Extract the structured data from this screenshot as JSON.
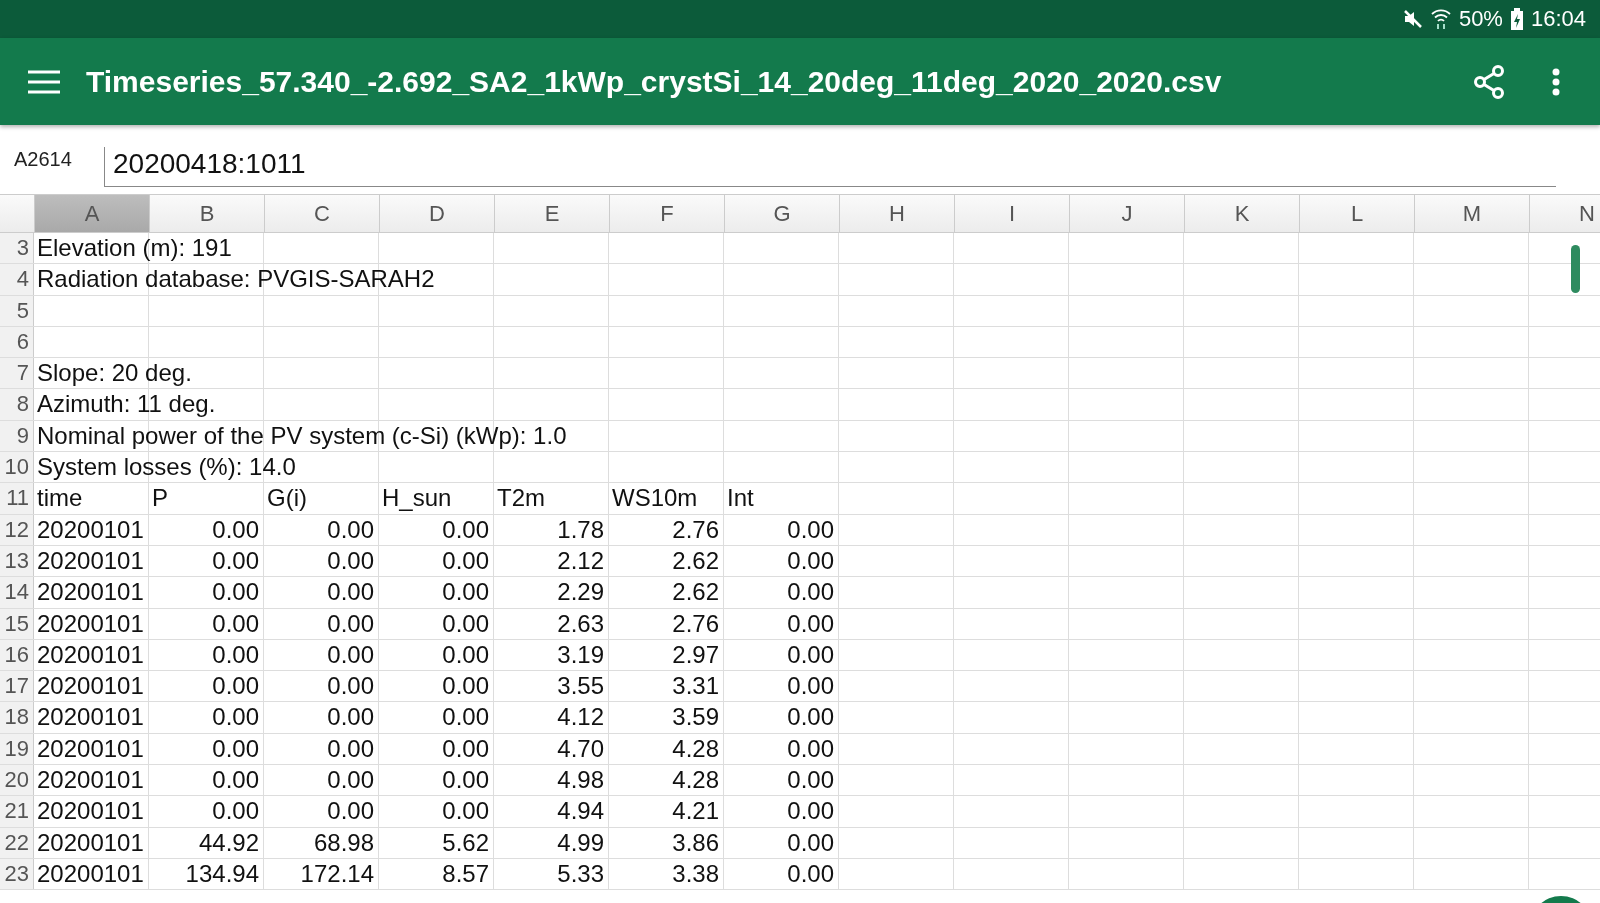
{
  "status_bar": {
    "battery": "50%",
    "time": "16:04"
  },
  "app_bar": {
    "title": "Timeseries_57.340_-2.692_SA2_1kWp_crystSi_14_20deg_11deg_2020_2020.csv"
  },
  "formula_bar": {
    "cell_ref": "A2614",
    "value": "20200418:1011"
  },
  "columns": [
    {
      "label": "A",
      "selected": true
    },
    {
      "label": "B",
      "selected": false
    },
    {
      "label": "C",
      "selected": false
    },
    {
      "label": "D",
      "selected": false
    },
    {
      "label": "E",
      "selected": false
    },
    {
      "label": "F",
      "selected": false
    },
    {
      "label": "G",
      "selected": false
    },
    {
      "label": "H",
      "selected": false
    },
    {
      "label": "I",
      "selected": false
    },
    {
      "label": "J",
      "selected": false
    },
    {
      "label": "K",
      "selected": false
    },
    {
      "label": "L",
      "selected": false
    },
    {
      "label": "M",
      "selected": false
    },
    {
      "label": "N",
      "selected": false
    }
  ],
  "rows": [
    {
      "number": "3",
      "kind": "note",
      "text": "Elevation (m): 191"
    },
    {
      "number": "4",
      "kind": "note",
      "text": "Radiation database: PVGIS-SARAH2"
    },
    {
      "number": "5",
      "kind": "empty"
    },
    {
      "number": "6",
      "kind": "empty"
    },
    {
      "number": "7",
      "kind": "note",
      "text": "Slope: 20 deg."
    },
    {
      "number": "8",
      "kind": "note",
      "text": "Azimuth: 11 deg."
    },
    {
      "number": "9",
      "kind": "note",
      "text": "Nominal power of the PV system (c-Si) (kWp): 1.0"
    },
    {
      "number": "10",
      "kind": "note",
      "text": "System losses (%): 14.0"
    },
    {
      "number": "11",
      "kind": "header",
      "cells": [
        "time",
        "P",
        "G(i)",
        "H_sun",
        "T2m",
        "WS10m",
        "Int"
      ]
    },
    {
      "number": "12",
      "kind": "data",
      "cells": [
        "20200101",
        "0.00",
        "0.00",
        "0.00",
        "1.78",
        "2.76",
        "0.00"
      ]
    },
    {
      "number": "13",
      "kind": "data",
      "cells": [
        "20200101",
        "0.00",
        "0.00",
        "0.00",
        "2.12",
        "2.62",
        "0.00"
      ]
    },
    {
      "number": "14",
      "kind": "data",
      "cells": [
        "20200101",
        "0.00",
        "0.00",
        "0.00",
        "2.29",
        "2.62",
        "0.00"
      ]
    },
    {
      "number": "15",
      "kind": "data",
      "cells": [
        "20200101",
        "0.00",
        "0.00",
        "0.00",
        "2.63",
        "2.76",
        "0.00"
      ]
    },
    {
      "number": "16",
      "kind": "data",
      "cells": [
        "20200101",
        "0.00",
        "0.00",
        "0.00",
        "3.19",
        "2.97",
        "0.00"
      ]
    },
    {
      "number": "17",
      "kind": "data",
      "cells": [
        "20200101",
        "0.00",
        "0.00",
        "0.00",
        "3.55",
        "3.31",
        "0.00"
      ]
    },
    {
      "number": "18",
      "kind": "data",
      "cells": [
        "20200101",
        "0.00",
        "0.00",
        "0.00",
        "4.12",
        "3.59",
        "0.00"
      ]
    },
    {
      "number": "19",
      "kind": "data",
      "cells": [
        "20200101",
        "0.00",
        "0.00",
        "0.00",
        "4.70",
        "4.28",
        "0.00"
      ]
    },
    {
      "number": "20",
      "kind": "data",
      "cells": [
        "20200101",
        "0.00",
        "0.00",
        "0.00",
        "4.98",
        "4.28",
        "0.00"
      ]
    },
    {
      "number": "21",
      "kind": "data",
      "cells": [
        "20200101",
        "0.00",
        "0.00",
        "0.00",
        "4.94",
        "4.21",
        "0.00"
      ]
    },
    {
      "number": "22",
      "kind": "data",
      "cells": [
        "20200101",
        "44.92",
        "68.98",
        "5.62",
        "4.99",
        "3.86",
        "0.00"
      ]
    },
    {
      "number": "23",
      "kind": "data",
      "cells": [
        "20200101",
        "134.94",
        "172.14",
        "8.57",
        "5.33",
        "3.38",
        "0.00"
      ]
    }
  ]
}
